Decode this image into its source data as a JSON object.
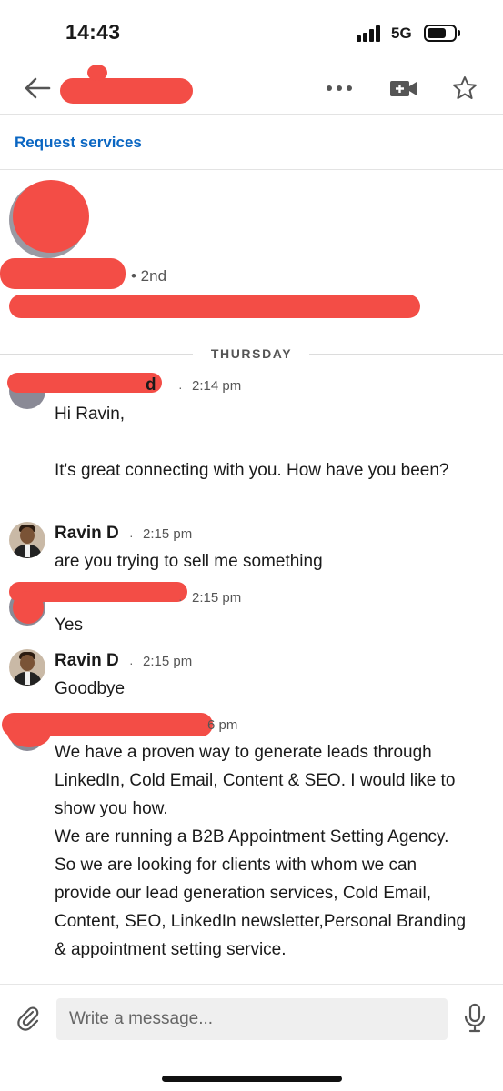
{
  "status_bar": {
    "time": "14:43",
    "network": "5G",
    "icons": [
      "signal-icon",
      "battery-icon"
    ]
  },
  "header": {
    "icons": [
      "back-arrow-icon",
      "more-dots-icon",
      "video-call-icon",
      "star-icon"
    ]
  },
  "request_link": "Request services",
  "profile": {
    "degree": "• 2nd"
  },
  "day_label": "THURSDAY",
  "messages": [
    {
      "name": "",
      "dot": "·",
      "time": "2:14 pm",
      "body": "Hi Ravin,\n\nIt's great connecting with you. How have you been?"
    },
    {
      "name": "Ravin D",
      "dot": "·",
      "time": "2:15 pm",
      "body": "are you trying to sell me something"
    },
    {
      "name": "",
      "dot": "·",
      "time": "2:15 pm",
      "body": "Yes"
    },
    {
      "name": "Ravin D",
      "dot": "·",
      "time": "2:15 pm",
      "body": "Goodbye"
    },
    {
      "name": "",
      "dot": "",
      "time": "6 pm",
      "body": "We have a proven way to generate leads through LinkedIn, Cold Email, Content & SEO. I would like to show you how.\nWe are running a B2B Appointment Setting Agency. So we are looking for clients with whom we can provide our lead generation services, Cold Email, Content, SEO, LinkedIn newsletter,Personal Branding & appointment setting service."
    }
  ],
  "composer": {
    "placeholder": "Write a message...",
    "icons": [
      "paperclip-icon",
      "microphone-icon"
    ]
  },
  "colors": {
    "link_blue": "#0a66c2",
    "redaction_red": "#f34d46"
  }
}
